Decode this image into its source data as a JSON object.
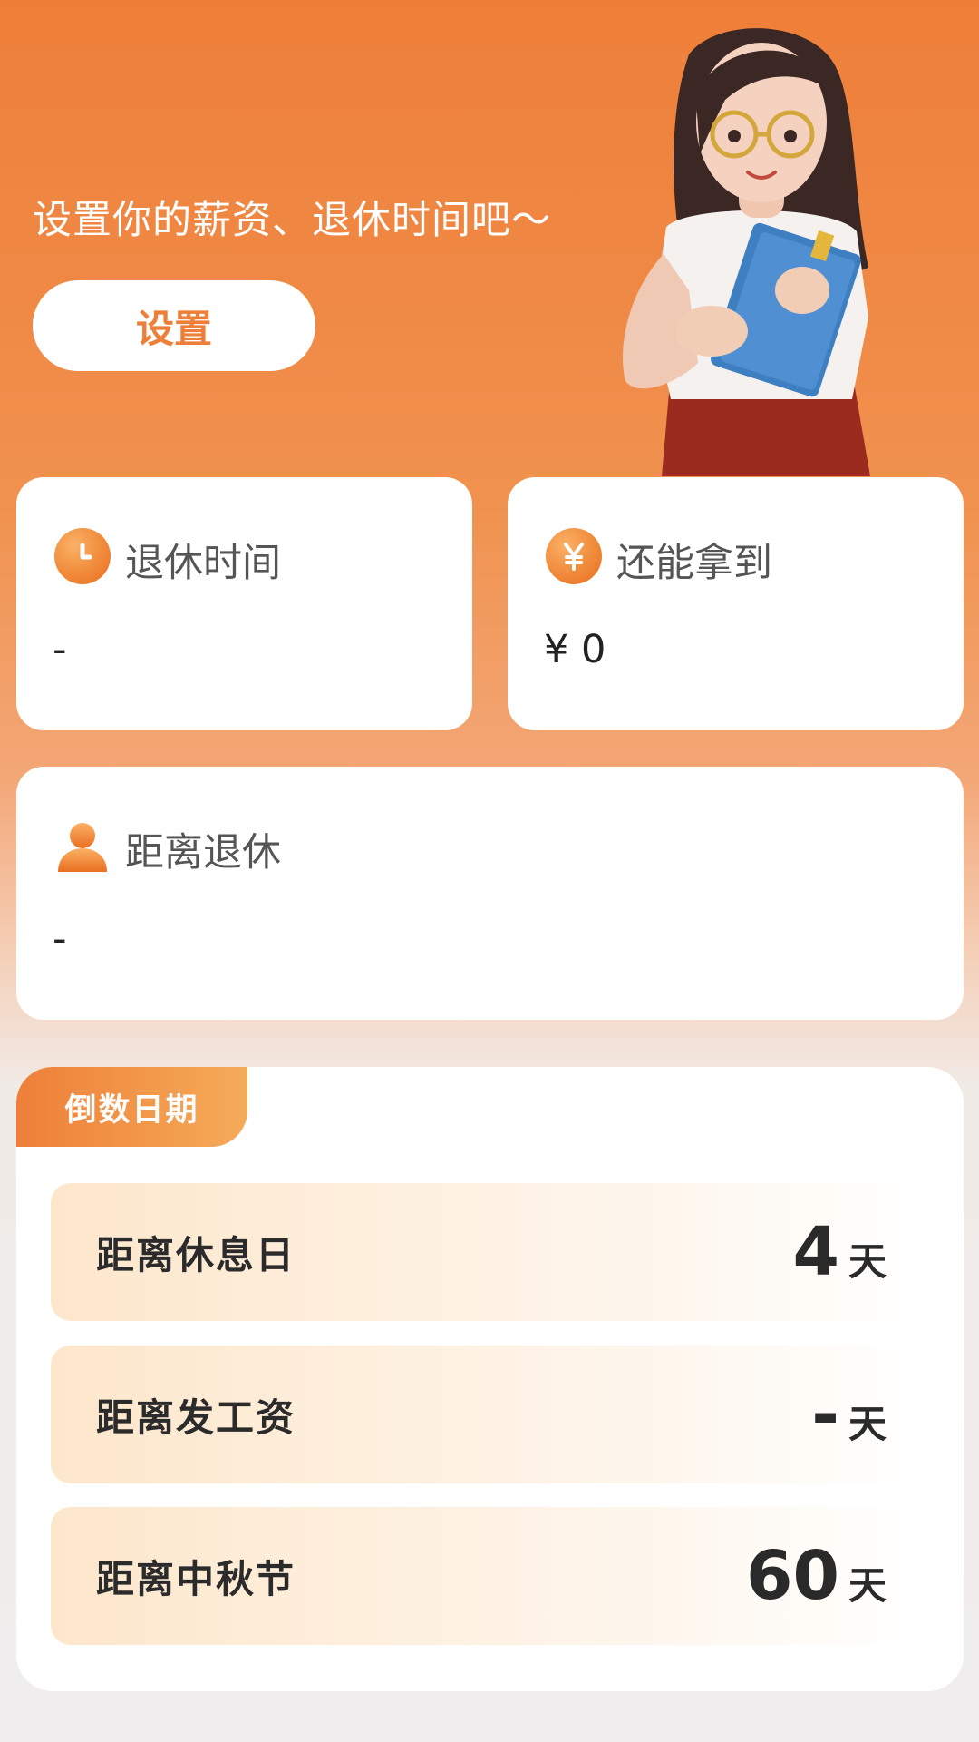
{
  "hero": {
    "prompt": "设置你的薪资、退休时间吧～",
    "setup_button": "设置"
  },
  "cards": {
    "retire_time": {
      "title": "退休时间",
      "value": "-",
      "icon": "clock-icon"
    },
    "remaining": {
      "title": "还能拿到",
      "value": "¥ 0",
      "icon": "yen-icon"
    },
    "countdown_retire": {
      "title": "距离退休",
      "value": "-",
      "icon": "person-icon"
    }
  },
  "countdown": {
    "tab_label": "倒数日期",
    "rows": [
      {
        "label": "距离休息日",
        "value": "4",
        "unit": "天"
      },
      {
        "label": "距离发工资",
        "value": "-",
        "unit": "天"
      },
      {
        "label": "距离中秋节",
        "value": "60",
        "unit": "天"
      }
    ]
  },
  "colors": {
    "accent": "#ee7f39",
    "card_background": "#ffffff",
    "page_background": "#efedee"
  }
}
